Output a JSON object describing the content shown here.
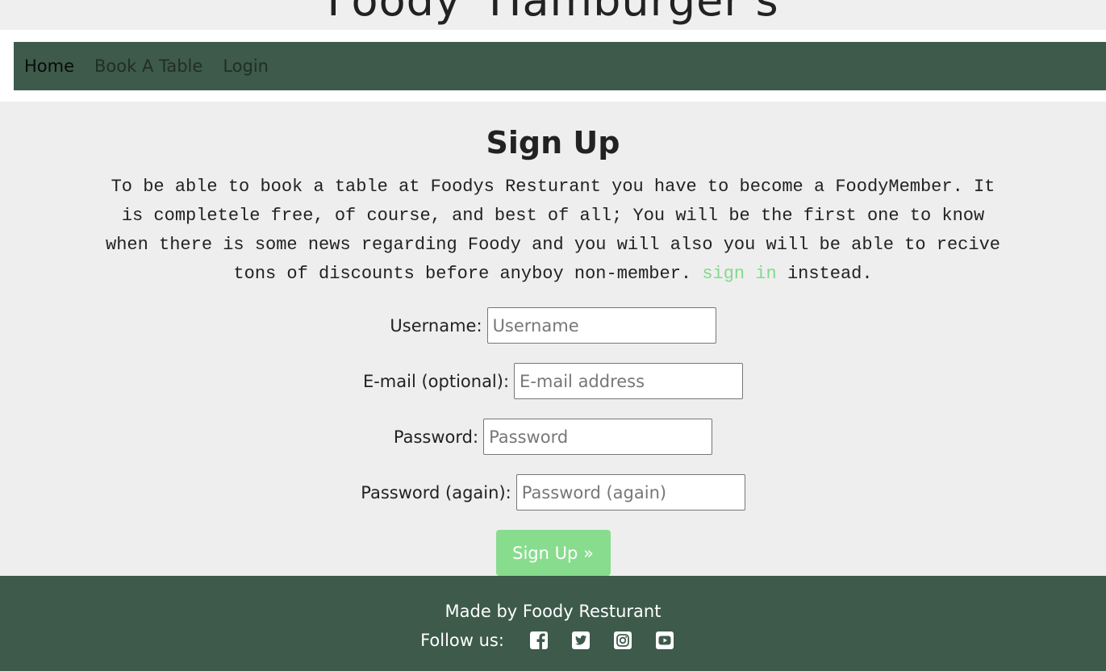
{
  "site": {
    "title": "Foody' Hamburger's"
  },
  "nav": {
    "items": [
      {
        "label": "Home"
      },
      {
        "label": "Book A Table"
      },
      {
        "label": "Login"
      }
    ]
  },
  "signup": {
    "heading": "Sign Up",
    "intro_text": "To be able to book a table at Foodys Resturant you have to become a FoodyMember. It is completele free, of course, and best of all; You will be the first one to know when there is some news regarding Foody and you will also you will be able to recive tons of discounts before anyboy non-member.",
    "signin_link": "sign in",
    "intro_suffix": "instead.",
    "fields": [
      {
        "label": "Username:",
        "placeholder": "Username"
      },
      {
        "label": "E-mail (optional):",
        "placeholder": "E-mail address"
      },
      {
        "label": "Password:",
        "placeholder": "Password"
      },
      {
        "label": "Password (again):",
        "placeholder": "Password (again)"
      }
    ],
    "submit_label": "Sign Up »"
  },
  "footer": {
    "made_by": "Made by Foody Resturant",
    "follow_label": "Follow us:",
    "social_icons": [
      "facebook-icon",
      "twitter-icon",
      "instagram-icon",
      "youtube-icon"
    ]
  },
  "colors": {
    "nav_background": "#3d5a4a",
    "accent_green": "#88dc8e",
    "link_green": "#84d98b",
    "page_background": "#eeeeee"
  }
}
